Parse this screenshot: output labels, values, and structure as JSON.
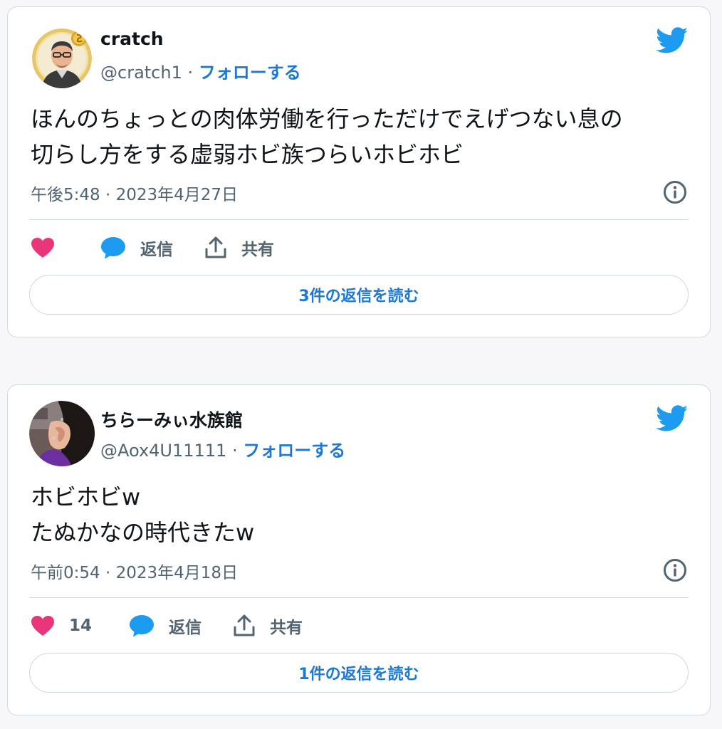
{
  "tweets": [
    {
      "author": {
        "display_name": "cratch",
        "handle": "@cratch1",
        "separator": " · ",
        "follow_label": "フォローする"
      },
      "text": "ほんのちょっとの肉体労働を行っただけでえげつない息の\n切らし方をする虚弱ホビ族つらいホビホビ",
      "timestamp": "午後5:48 · 2023年4月27日",
      "like_count": "",
      "reply_label": "返信",
      "share_label": "共有",
      "read_replies_label": "3件の返信を読む"
    },
    {
      "author": {
        "display_name": "ちらーみぃ水族館",
        "handle": "@Aox4U11111",
        "separator": " · ",
        "follow_label": "フォローする"
      },
      "text": "ホビホビw\nたぬかなの時代きたw",
      "timestamp": "午前0:54 · 2023年4月18日",
      "like_count": "14",
      "reply_label": "返信",
      "share_label": "共有",
      "read_replies_label": "1件の返信を読む"
    }
  ],
  "icons": {
    "like": "heart-icon",
    "reply": "speech-bubble-icon",
    "share": "share-upload-icon",
    "info": "info-icon",
    "brand": "twitter-bird-icon"
  },
  "colors": {
    "like": "#e9357a",
    "reply": "#1d9bf0",
    "brand": "#1d9bf0",
    "link": "#1d77d4",
    "muted": "#536471",
    "border": "#cfd9de"
  }
}
